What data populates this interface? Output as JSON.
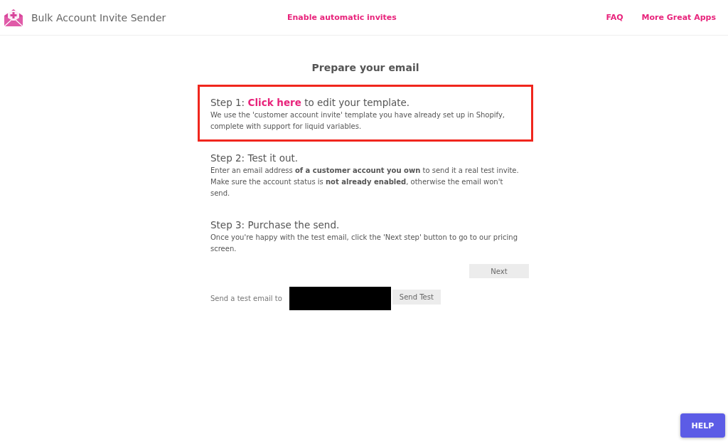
{
  "header": {
    "app_name": "Bulk Account Invite Sender",
    "center_link": "Enable automatic invites",
    "links": [
      "FAQ",
      "More Great Apps"
    ]
  },
  "main": {
    "title": "Prepare your email",
    "steps": [
      {
        "title_before": "Step 1: ",
        "link": "Click here",
        "title_after": " to edit your template.",
        "lines": [
          "We use the 'customer account invite' template you have already set up in Shopify, complete with support for liquid variables."
        ],
        "highlighted": true
      },
      {
        "title_before": "Step 2: Test it out.",
        "lines": [
          "Enter an email address **of a customer account you own** to send it a real test invite.",
          "Make sure the account status is **not already enabled**, otherwise the email won't send."
        ],
        "highlighted": false
      },
      {
        "title_before": "Step 3: Purchase the send.",
        "lines": [
          "Once you're happy with the test email, click the 'Next step' button to go to our pricing screen."
        ],
        "highlighted": false
      }
    ],
    "next_button": "Next",
    "test_label": "Send a test email to",
    "test_field": {
      "redacted": true
    },
    "send_button": "Send Test"
  },
  "help_button": "HELP"
}
